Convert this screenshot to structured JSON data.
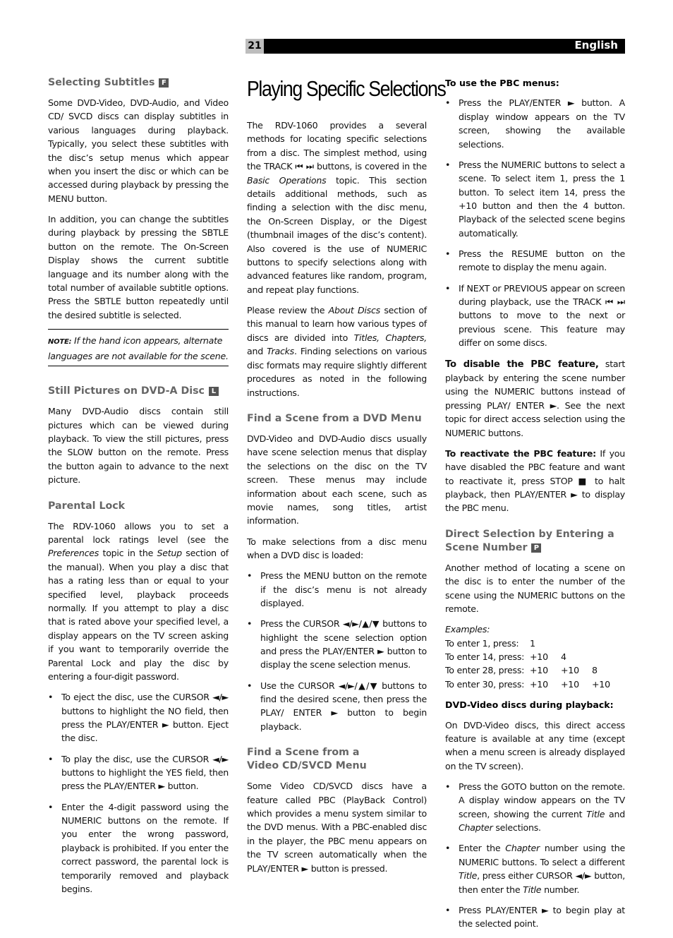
{
  "header": {
    "page_number": "21",
    "language": "English"
  },
  "col1": {
    "subtitles": {
      "heading": "Selecting Subtitles",
      "badge": "F",
      "p1": "Some DVD-Video, DVD-Audio, and Video CD/ SVCD discs can display subtitles in various languages during playback. Typically, you select these subtitles with the disc’s setup menus which appear when you insert the disc or which can be accessed during playback by pressing the MENU button.",
      "p2": "In addition, you can change the subtitles during playback by pressing the SBTLE button on the remote. The On-Screen Display shows the current subtitle language and its number along with the total number of available subtitle options. Press the SBTLE button repeatedly until the desired subtitle is selected.",
      "note_label": "NOTE:",
      "note_text": " If the hand icon appears, alternate languages are not available for the scene."
    },
    "still": {
      "heading": "Still Pictures on DVD-A Disc",
      "badge": "L",
      "p1": "Many DVD-Audio discs contain still pictures which can be viewed during playback. To view the still pictures, press the SLOW button on the remote. Press the button again to advance to the next picture."
    },
    "parental": {
      "heading": "Parental Lock",
      "p1a": "The RDV-1060 allows you to set a parental lock ratings level (see the ",
      "p1_pref": "Preferences",
      "p1b": " topic in the ",
      "p1_setup": "Setup",
      "p1c": " section of the manual). When you play a disc that has a rating less than or equal to your specified level, playback proceeds normally. If you attempt to play a disc that is rated above your specified level, a display appears on the TV screen asking if you want to temporarily override the Parental Lock and play the disc by entering a four-digit password.",
      "bullets": [
        "To eject the disc, use the CURSOR ◄/► buttons to highlight the NO field, then press the PLAY/ENTER ► button. Eject the disc.",
        "To play the disc, use the CURSOR ◄/► buttons to highlight the YES field, then press the PLAY/ENTER ► button.",
        "Enter the 4-digit password using the NUMERIC buttons on the remote. If you enter the wrong password, playback is prohibited. If you enter the correct password, the parental lock is temporarily removed and playback begins."
      ]
    }
  },
  "col2": {
    "title": "Playing Specific Selections",
    "intro_a": "The RDV-1060 provides a several methods for locating specific selections from a disc. The simplest method, using the TRACK ⏮ ⏭ buttons, is covered in the ",
    "intro_basic": "Basic Operations",
    "intro_b": " topic. This section details additional methods, such as finding a selection with the disc menu, the On-Screen Display, or the Digest (thumbnail images of the disc’s content). Also covered is the use of NUMERIC buttons to specify selections along with advanced features like random, program, and repeat play functions.",
    "review_a": "Please review the ",
    "review_about": "About Discs",
    "review_b": " section of this manual to learn how various types of discs are divided into ",
    "review_titles": "Titles, Chapters,",
    "review_c": " and ",
    "review_tracks": "Tracks",
    "review_d": ". Finding selections on various disc formats may require slightly different procedures as noted in the following instructions.",
    "dvd_menu": {
      "heading": "Find a Scene from a DVD Menu",
      "p1": "DVD-Video and DVD-Audio discs usually have scene selection menus that display the selections on the disc on the TV screen. These menus may include information about each scene, such as movie names, song titles, artist information.",
      "p2": "To make selections from a disc menu when a DVD disc is loaded:",
      "bullets": [
        "Press the MENU button on the remote if the disc’s menu is not already displayed.",
        "Press the CURSOR ◄/►/▲/▼ buttons to highlight the scene selection option and press the PLAY/ENTER ► button to display the scene selection menus.",
        "Use the CURSOR ◄/►/▲/▼ buttons to find the desired scene, then press the PLAY/ ENTER ► button to begin playback."
      ]
    },
    "vcd_menu": {
      "heading_line1": "Find a Scene from a",
      "heading_line2": "Video CD/SVCD Menu",
      "p1": "Some Video CD/SVCD discs have a feature called PBC (PlayBack Control) which provides a menu system similar to the DVD menus. With a PBC-enabled disc in the player, the PBC menu appears on the TV screen automatically when the PLAY/ENTER ► button is pressed."
    }
  },
  "col3": {
    "pbc": {
      "heading": "To use the PBC menus:",
      "bullets": [
        "Press the PLAY/ENTER ► button. A display window appears on the TV screen, showing the available selections.",
        "Press the NUMERIC buttons to select a scene. To select item 1, press the 1 button. To select item 14, press the +10 button and then the 4 button. Playback of the selected scene begins automatically.",
        "Press the RESUME button on the remote to display the menu again.",
        "If NEXT or PREVIOUS appear on screen during playback, use the TRACK ⏮ ⏭ buttons to move to the next or previous scene. This feature may differ on some discs."
      ],
      "disable_lead": "To disable the PBC feature,",
      "disable_text": " start playback by entering the scene number using the NUMERIC buttons instead of pressing PLAY/ ENTER ►. See the next topic for direct access selection using the NUMERIC buttons.",
      "reactivate_lead": "To reactivate the PBC feature:",
      "reactivate_text": " If you have disabled the PBC feature and want to reactivate it, press STOP ■ to halt playback, then PLAY/ENTER ► to display the PBC menu."
    },
    "direct": {
      "heading_line1": "Direct Selection by Entering a",
      "heading_line2": "Scene Number",
      "badge": "P",
      "p1": "Another method of locating a scene on the disc is to enter the number of the scene using the NUMERIC buttons on the remote.",
      "examples_label": "Examples:",
      "examples": [
        {
          "label": "To enter 1, press:",
          "keys": [
            "1",
            "",
            ""
          ]
        },
        {
          "label": "To enter 14, press:",
          "keys": [
            "+10",
            "4",
            ""
          ]
        },
        {
          "label": "To enter 28, press:",
          "keys": [
            "+10",
            "+10",
            "8"
          ]
        },
        {
          "label": "To enter 30, press:",
          "keys": [
            "+10",
            "+10",
            "+10"
          ]
        }
      ],
      "dvd_heading": "DVD-Video discs during playback:",
      "dvd_p1": "On DVD-Video discs, this direct access feature is available at any time (except when a menu screen is already displayed on the TV screen).",
      "b1a": "Press the GOTO button on the remote. A display window appears on the TV screen, showing the current ",
      "b1_title": "Title",
      "b1b": " and ",
      "b1_chapter": "Chapter",
      "b1c": " selections.",
      "b2a": "Enter the ",
      "b2_chapter": "Chapter",
      "b2b": " number using the NUMERIC buttons. To select a different ",
      "b2_title": "Title",
      "b2c": ", press either CURSOR ◄/► button, then enter the ",
      "b2_title2": "Title",
      "b2d": " number.",
      "b3": "Press PLAY/ENTER ► to begin play at the selected point."
    }
  }
}
